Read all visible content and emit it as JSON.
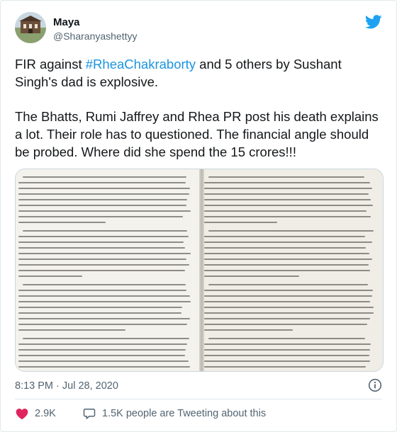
{
  "user": {
    "display_name": "Maya",
    "handle": "@Sharanyashettyy",
    "avatar_icon": "avatar-photo"
  },
  "tweet": {
    "line1_prefix": "FIR against ",
    "hashtag": "#RheaChakraborty",
    "line1_suffix": " and 5 others by Sushant Singh's dad is explosive.",
    "paragraph2": "The Bhatts, Rumi Jaffrey and Rhea PR post his death explains a lot. Their role has to questioned. The financial angle should be probed. Where did she spend the 15 crores!!!"
  },
  "meta": {
    "timestamp": "8:13 PM · Jul 28, 2020"
  },
  "actions": {
    "likes": "2.9K",
    "replies": "1.5K people are Tweeting about this"
  },
  "icons": {
    "brand": "twitter-bird-icon",
    "info": "info-icon",
    "like": "heart-icon",
    "reply": "speech-bubble-icon"
  },
  "colors": {
    "brand": "#1da1f2",
    "link": "#1b95e0",
    "secondary_text": "#536471",
    "like": "#e0245e"
  }
}
